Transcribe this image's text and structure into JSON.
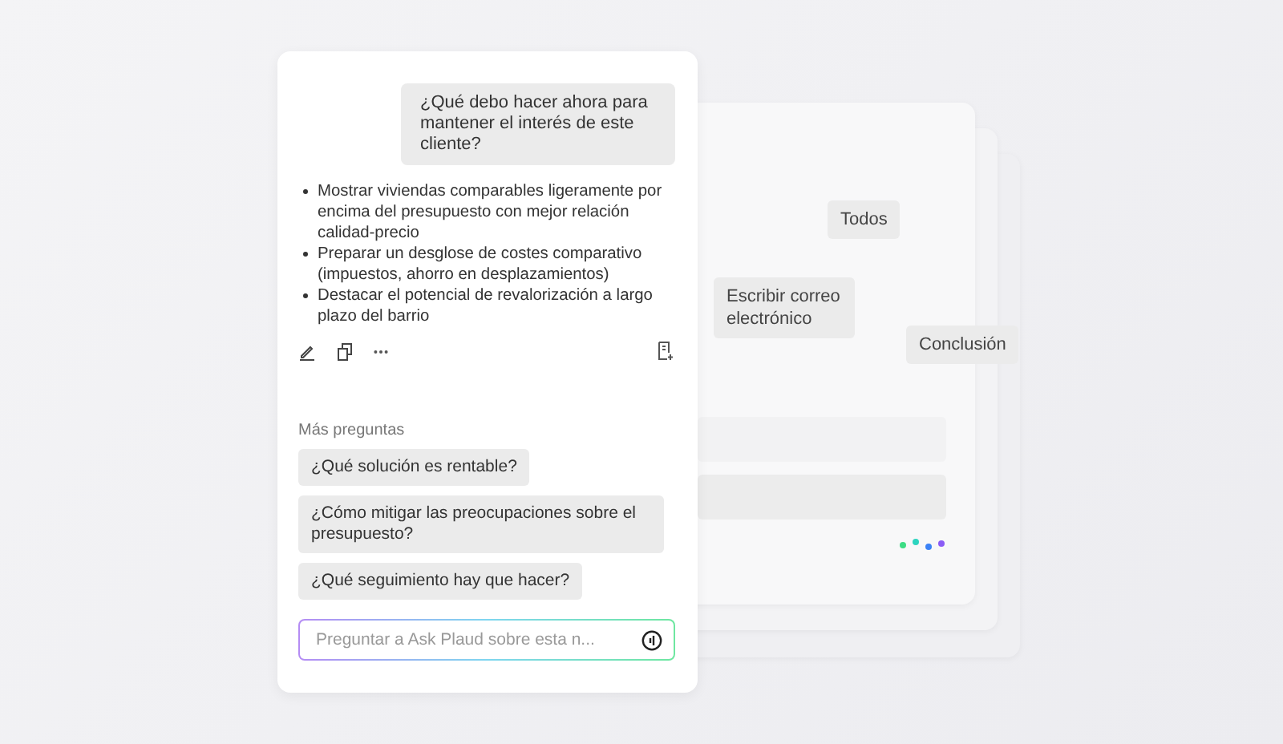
{
  "conversation": {
    "question": "¿Qué debo hacer ahora para mantener el interés de este cliente?",
    "answer_points": [
      "Mostrar viviendas comparables ligeramente por encima del presupuesto con mejor relación calidad-precio",
      "Preparar un desglose de costes comparativo (impuestos, ahorro en desplazamientos)",
      "Destacar el potencial de revalorización a largo plazo del barrio"
    ]
  },
  "more_questions": {
    "title": "Más preguntas",
    "items": [
      "¿Qué solución es rentable?",
      "¿Cómo mitigar las preocupaciones sobre el presupuesto?",
      "¿Qué seguimiento hay que hacer?"
    ]
  },
  "input": {
    "placeholder": "Preguntar a Ask Plaud sobre esta n..."
  },
  "background_chips": [
    "Todos",
    "Escribir correo electrónico",
    "Conclusión"
  ]
}
